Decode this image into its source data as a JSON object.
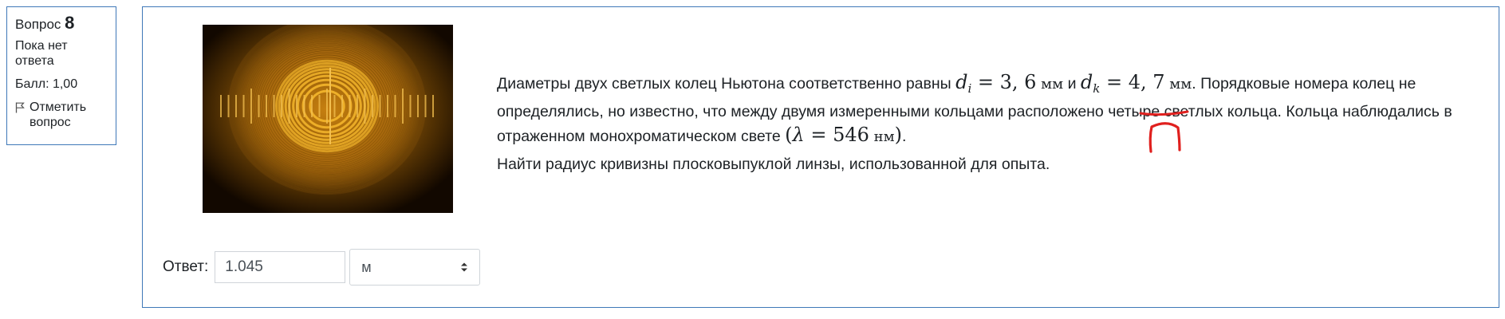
{
  "info": {
    "question_label": "Вопрос",
    "question_number": "8",
    "state_line1": "Пока нет",
    "state_line2": "ответа",
    "grade": "Балл: 1,00",
    "flag_line1": "Отметить",
    "flag_line2": "вопрос"
  },
  "question": {
    "p1_a": "Диаметры двух светлых колец Ньютона соответственно равны ",
    "di": "d",
    "di_sub": "i",
    "eq_value1": " = 3, 6",
    "unit_mm1": " мм",
    "and": " и ",
    "dk": "d",
    "dk_sub": "k",
    "eq_value2": " = 4, 7",
    "unit_mm2": " мм",
    "p1_b": ". Порядковые номера колец не определялись, но известно, что между двумя измеренными кольцами расположено ",
    "four": "четыре",
    "p1_c": " светлых кольца. Кольца наблюдались в отраженном монохроматическом свете ",
    "lambda_open": "(",
    "lambda": "λ",
    "lambda_value": " = 546",
    "unit_nm": " нм",
    "lambda_close": ")",
    "p1_end": ".",
    "p2": "Найти радиус кривизны плосковыпуклой линзы, использованной для опыта."
  },
  "answer": {
    "label": "Ответ:",
    "value": "1.045",
    "unit_selected": "м"
  },
  "annotation": {
    "handwritten": "n",
    "color": "#e0201e"
  },
  "colors": {
    "border": "#3f78b8",
    "ring": "#e5a020"
  }
}
